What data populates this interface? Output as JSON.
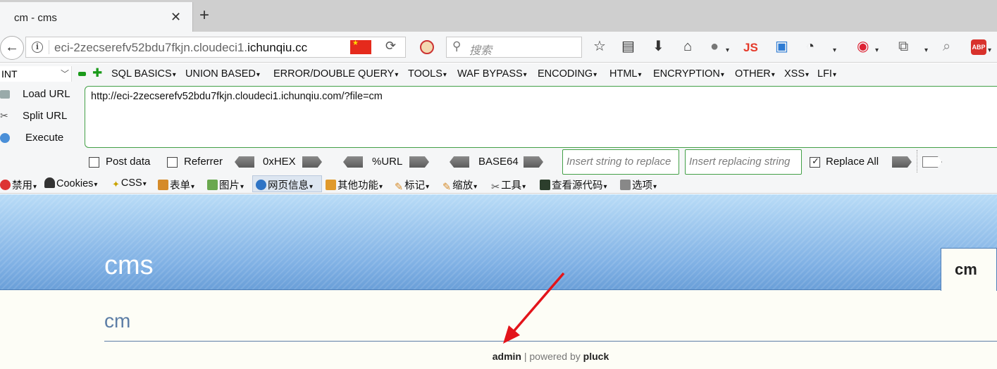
{
  "tab": {
    "title": "cm - cms",
    "close": "✕",
    "new_tab": "+"
  },
  "nav": {
    "url_display_prefix": "eci-2zecserefv52bdu7fkjn.cloudeci1.",
    "url_display_domain": "ichunqiu.cc",
    "search_placeholder": "搜索",
    "js_label": "JS",
    "abp_label": "ABP"
  },
  "hackbar_menu": {
    "select_value": "INT",
    "items": [
      "SQL BASICS",
      "UNION BASED",
      "ERROR/DOUBLE QUERY",
      "TOOLS",
      "WAF BYPASS",
      "ENCODING",
      "HTML",
      "ENCRYPTION",
      "OTHER",
      "XSS",
      "LFI"
    ]
  },
  "hackbar": {
    "load_url": "Load URL",
    "split_url": "Split URL",
    "execute": "Execute",
    "url_value": "http://eci-2zecserefv52bdu7fkjn.cloudeci1.ichunqiu.com/?file=cm",
    "post_data": "Post data",
    "referrer": "Referrer",
    "hex": "0xHEX",
    "url_enc": "%URL",
    "base64": "BASE64",
    "insert_replace_ph": "Insert string to replace",
    "insert_replacing_ph": "Insert replacing string",
    "replace_all": "Replace All"
  },
  "webdev": {
    "items": [
      "禁用",
      "Cookies",
      "CSS",
      "表单",
      "图片",
      "网页信息",
      "其他功能",
      "标记",
      "缩放",
      "工具",
      "查看源代码",
      "选项"
    ]
  },
  "page": {
    "site_title": "cms",
    "nav_tab": "cm",
    "heading": "cm",
    "footer_admin": "admin",
    "footer_sep": "|",
    "footer_powered": "powered by",
    "footer_pluck": "pluck"
  }
}
